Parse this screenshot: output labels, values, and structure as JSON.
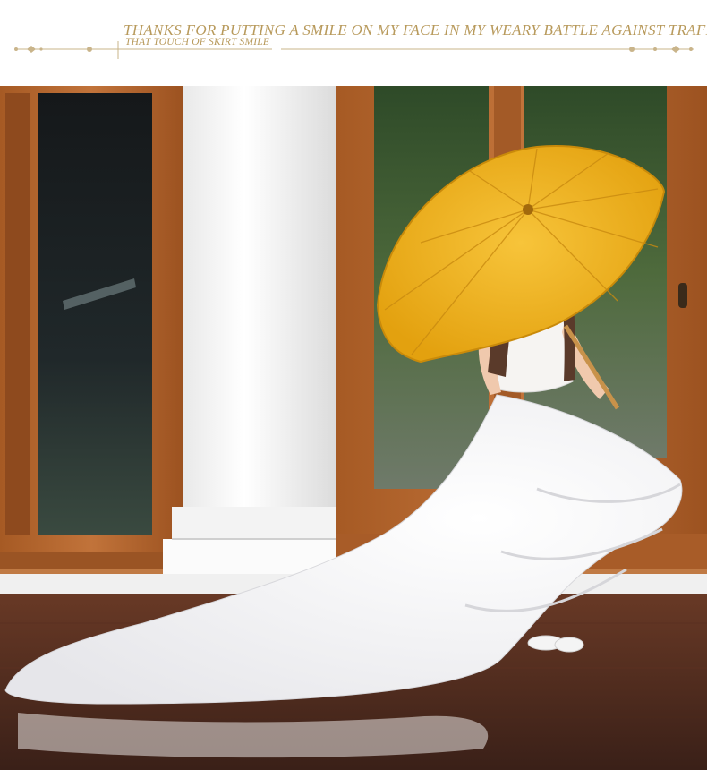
{
  "header": {
    "headline": "THANKS FOR PUTTING A SMILE ON MY FACE IN MY WEARY BATTLE AGAINST TRAFFIC!",
    "subline": "THAT TOUCH OF SKIRT SMILE"
  },
  "colors": {
    "accent_gold": "#b89a5c",
    "umbrella_yellow": "#f2b21c",
    "door_wood": "#b5652c",
    "dress_white": "#f7f6f4"
  },
  "photo": {
    "subject": "girl-in-white-ball-gown-with-yellow-paper-umbrella"
  }
}
